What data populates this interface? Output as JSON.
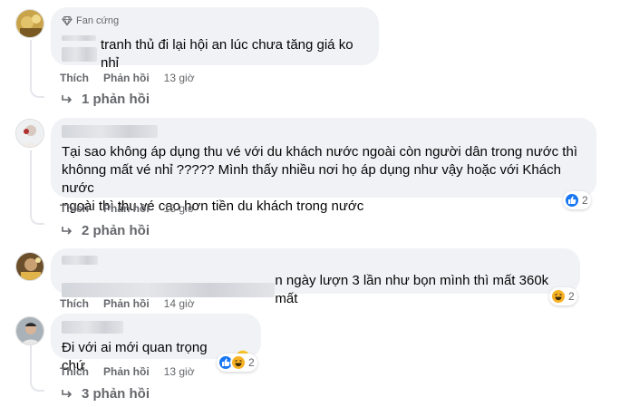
{
  "comments": [
    {
      "badge": "Fan cứng",
      "text": "tranh thủ đi lại hội an lúc chưa tăng giá ko nhỉ",
      "like_label": "Thích",
      "reply_label": "Phản hồi",
      "time": "13 giờ",
      "replies": "1 phản hồi"
    },
    {
      "text": "Tại sao không áp dụng thu vé với du khách nước ngoài còn người dân trong nước thì khônng mất vé nhỉ ????? Mình thấy nhiều nơi họ áp dụng như vậy hoặc với Khách nước ngoài thì thu vé cao hơn tiền du khách trong nước",
      "line1": "Tại sao không áp dụng thu vé với du khách nước ngoài còn người dân trong nước thì",
      "line2": "khônng mất vé nhỉ ????? Mình thấy nhiều nơi họ áp dụng như vậy hoặc với Khách nước",
      "line3": "ngoài thì thu vé cao hơn tiền du khách trong nước",
      "like_label": "Thích",
      "reply_label": "Phản hồi",
      "time": "15 giờ",
      "reaction_count": "2",
      "replies": "2 phản hồi"
    },
    {
      "text": "n ngày lượn 3 lần như bọn mình thì mất 360k mất",
      "like_label": "Thích",
      "reply_label": "Phản hồi",
      "time": "14 giờ",
      "reaction_count": "2"
    },
    {
      "text": "Đi với ai mới quan trọng chứ",
      "like_label": "Thích",
      "reply_label": "Phản hồi",
      "time": "13 giờ",
      "reaction_count": "2",
      "replies": "3 phản hồi"
    }
  ],
  "icons": {
    "badge": "diamond-icon",
    "reply_arrow": "reply-arrow-icon",
    "like": "like-reaction-icon",
    "haha": "haha-reaction-icon",
    "smile": "smile-emoji-icon"
  },
  "colors": {
    "bubble": "#f0f2f5",
    "meta": "#65676b",
    "like_blue": "#1877f2",
    "haha_yellow": "#f7b125"
  }
}
